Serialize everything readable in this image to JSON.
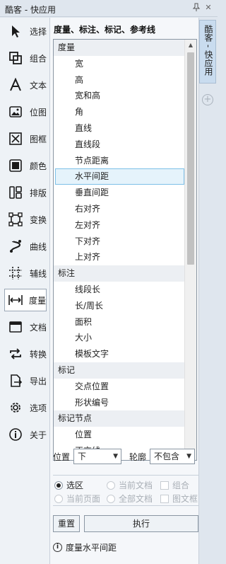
{
  "window": {
    "title": "酷客 - 快应用",
    "pin_icon": "pin-icon",
    "close_icon": "close-icon"
  },
  "sidebar": {
    "items": [
      {
        "label": "选择",
        "icon": "cursor-arrow-icon"
      },
      {
        "label": "组合",
        "icon": "group-squares-icon"
      },
      {
        "label": "文本",
        "icon": "text-a-icon"
      },
      {
        "label": "位图",
        "icon": "image-icon"
      },
      {
        "label": "图框",
        "icon": "frame-x-icon"
      },
      {
        "label": "颜色",
        "icon": "color-square-icon"
      },
      {
        "label": "排版",
        "icon": "layout-columns-icon"
      },
      {
        "label": "变换",
        "icon": "transform-icon"
      },
      {
        "label": "曲线",
        "icon": "curve-icon"
      },
      {
        "label": "辅线",
        "icon": "guides-icon"
      },
      {
        "label": "度量",
        "icon": "measure-icon"
      },
      {
        "label": "文档",
        "icon": "document-icon"
      },
      {
        "label": "转换",
        "icon": "convert-icon"
      },
      {
        "label": "导出",
        "icon": "export-icon"
      },
      {
        "label": "选项",
        "icon": "gear-icon"
      },
      {
        "label": "关于",
        "icon": "info-icon"
      }
    ],
    "active_index": 10
  },
  "main": {
    "heading": "度量、标注、标记、参考线",
    "list": [
      {
        "type": "group",
        "label": "度量"
      },
      {
        "type": "item",
        "label": "宽"
      },
      {
        "type": "item",
        "label": "高"
      },
      {
        "type": "item",
        "label": "宽和高"
      },
      {
        "type": "item",
        "label": "角"
      },
      {
        "type": "item",
        "label": "直线"
      },
      {
        "type": "item",
        "label": "直线段"
      },
      {
        "type": "item",
        "label": "节点距离"
      },
      {
        "type": "item",
        "label": "水平间距",
        "selected": true
      },
      {
        "type": "item",
        "label": "垂直间距"
      },
      {
        "type": "item",
        "label": "右对齐"
      },
      {
        "type": "item",
        "label": "左对齐"
      },
      {
        "type": "item",
        "label": "下对齐"
      },
      {
        "type": "item",
        "label": "上对齐"
      },
      {
        "type": "group",
        "label": "标注"
      },
      {
        "type": "item",
        "label": "线段长"
      },
      {
        "type": "item",
        "label": "长/周长"
      },
      {
        "type": "item",
        "label": "面积"
      },
      {
        "type": "item",
        "label": "大小"
      },
      {
        "type": "item",
        "label": "模板文字"
      },
      {
        "type": "group",
        "label": "标记"
      },
      {
        "type": "item",
        "label": "交点位置"
      },
      {
        "type": "item",
        "label": "形状编号"
      },
      {
        "type": "group",
        "label": "标记节点"
      },
      {
        "type": "item",
        "label": "位置"
      },
      {
        "type": "item",
        "label": "正交线"
      }
    ],
    "position_label": "位置",
    "position_value": "下",
    "outline_label": "轮廓",
    "outline_value": "不包含",
    "scope": {
      "selection": "选区",
      "current_doc": "当前文档",
      "group": "组合",
      "current_page": "当前页面",
      "all_docs": "全部文档",
      "image_frame": "图文框"
    },
    "reset_label": "重置",
    "execute_label": "执行",
    "status_text": "度量水平间距"
  },
  "dock": {
    "tab_label": "酷客 - 快应用",
    "add_icon": "plus-circle-icon"
  }
}
